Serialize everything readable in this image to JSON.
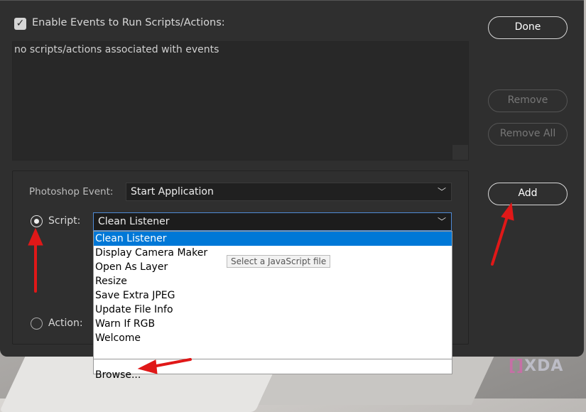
{
  "dialog": {
    "enable_label": "Enable Events to Run Scripts/Actions:",
    "enable_checked": true,
    "list_empty_text": "no scripts/actions associated with events",
    "buttons": {
      "done": "Done",
      "remove": "Remove",
      "remove_all": "Remove All",
      "add": "Add"
    },
    "event_label": "Photoshop Event:",
    "event_value": "Start Application",
    "script_label": "Script:",
    "script_value": "Clean Listener",
    "action_label": "Action:",
    "script_selected": true
  },
  "dropdown": {
    "options": [
      "Clean Listener",
      "Display Camera Maker",
      "Open As Layer",
      "Resize",
      "Save Extra JPEG",
      "Update File Info",
      "Warn If RGB",
      "Welcome"
    ],
    "highlighted": "Clean Listener",
    "browse": "Browse..."
  },
  "tooltip": "Select a JavaScript file",
  "watermark": "XDA",
  "annotation_color": "#e01818"
}
